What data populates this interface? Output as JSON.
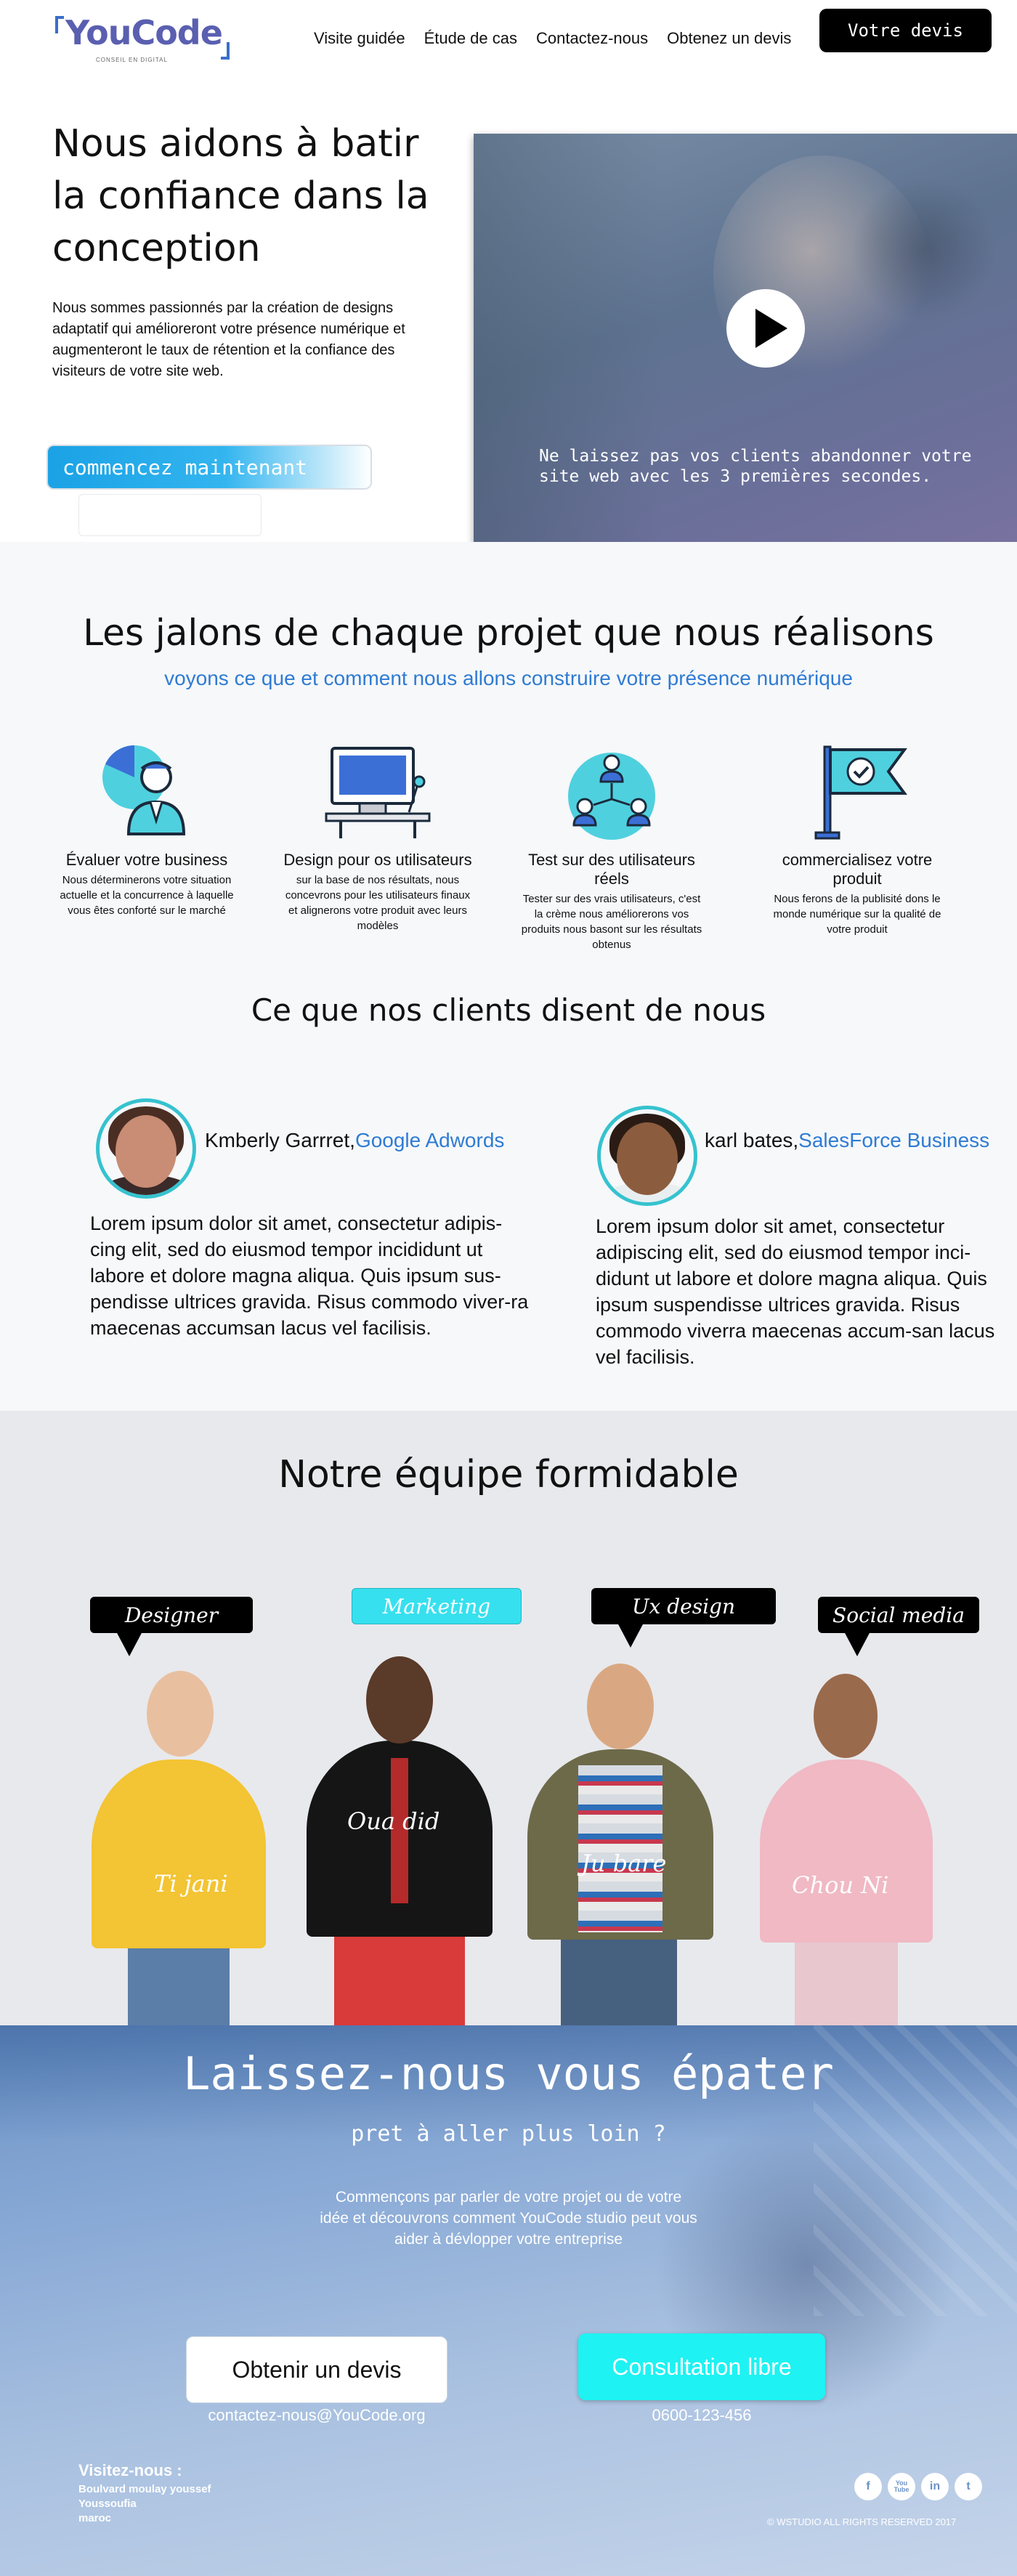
{
  "header": {
    "logo_text": "YouCode",
    "logo_tagline": "CONSEIL EN DIGITAL",
    "nav": [
      "Visite guidée",
      "Étude de cas",
      "Contactez-nous",
      "Obtenez un devis"
    ],
    "cta": "Votre devis"
  },
  "hero": {
    "title": "Nous aidons à batir la confiance dans la conception",
    "description": "Nous sommes passionnés par la création de designs adaptatif qui amélioreront votre présence numérique et augmenteront le taux de rétention et la confiance des visiteurs de votre site web.",
    "start_button": "commencez maintenant",
    "video_caption": "Ne laissez pas vos clients abandonner votre site web avec les 3 premières secondes."
  },
  "milestones": {
    "title": "Les jalons de chaque projet que nous réalisons",
    "subtitle": "voyons ce que et comment nous allons construire votre présence numérique",
    "items": [
      {
        "title": "Évaluer votre business",
        "text": "Nous déterminerons votre situation actuelle et la concurrence à laquelle vous êtes conforté sur le marché",
        "icon": "business-analysis-icon"
      },
      {
        "title": "Design pour os utilisateurs",
        "text": "sur la base de nos résultats, nous concevrons pour les utilisateurs finaux et alignerons votre produit avec leurs modèles",
        "icon": "desktop-design-icon"
      },
      {
        "title": "Test sur des utilisateurs réels",
        "text": "Tester sur des vrais utilisateurs, c'est la crème nous améliorerons vos produits nous basont sur les résultats obtenus",
        "icon": "user-network-icon"
      },
      {
        "title": "commercialisez votre produit",
        "text": "Nous ferons de la publisité dons le monde numérique sur la qualité de votre produit",
        "icon": "flag-check-icon"
      }
    ]
  },
  "testimonials": {
    "title": "Ce que nos clients disent de nous",
    "items": [
      {
        "name": "Kmberly Garrret,",
        "company": "Google Adwords",
        "text": "Lorem ipsum dolor sit amet, consectetur adipis-cing elit, sed do eiusmod tempor incididunt ut labore et dolore magna aliqua. Quis ipsum sus-pendisse ultrices gravida. Risus commodo viver-ra maecenas accumsan lacus vel facilisis."
      },
      {
        "name": "karl bates,",
        "company": "SalesForce Business",
        "text": "Lorem ipsum dolor sit amet, consectetur adipiscing elit, sed do eiusmod tempor inci-didunt ut labore et dolore magna aliqua. Quis ipsum suspendisse ultrices gravida. Risus commodo viverra maecenas accum-san lacus vel facilisis."
      }
    ]
  },
  "team": {
    "title": "Notre équipe formidable",
    "members": [
      {
        "role": "Designer",
        "name": "Ti jani"
      },
      {
        "role": "Marketing",
        "name": "Oua did"
      },
      {
        "role": "Ux design",
        "name": "Ju bare"
      },
      {
        "role": "Social media",
        "name": "Chou Ni"
      }
    ]
  },
  "banner": {
    "title": "Laissez-nous vous épater",
    "subtitle": "pret à aller plus loin ?",
    "text": "Commençons par parler de votre projet ou de votre idée et découvrons comment YouCode studio peut vous aider à dévlopper votre entreprise",
    "quote_button": "Obtenir un devis",
    "consult_button": "Consultation libre",
    "email": "contactez-nous@YouCode.org",
    "phone": "0600-123-456",
    "visit_title": "Visitez-nous :",
    "address": [
      "Boulvard moulay youssef",
      "Youssoufia",
      "maroc"
    ],
    "social": [
      "f",
      "You Tube",
      "in",
      "t"
    ],
    "copyright": "© WSTUDIO ALL RIGHTS RESERVED 2017"
  }
}
